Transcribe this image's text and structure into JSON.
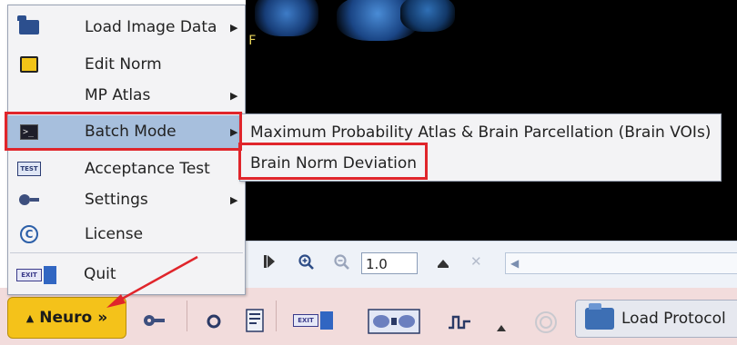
{
  "viewer": {
    "orientation_marker": "F",
    "zoom_value": "1.0"
  },
  "menu": {
    "items": [
      {
        "label": "Load Image Data",
        "icon": "open-folder-icon",
        "has_submenu": true
      },
      {
        "label": "Edit Norm",
        "icon": "edit-norm-icon",
        "has_submenu": false
      },
      {
        "label": "MP Atlas",
        "icon": "",
        "has_submenu": true
      },
      {
        "label": "Batch Mode",
        "icon": "terminal-icon",
        "has_submenu": true,
        "selected": true
      },
      {
        "label": "Acceptance Test",
        "icon": "test-icon",
        "has_submenu": false
      },
      {
        "label": "Settings",
        "icon": "gear-icon",
        "has_submenu": true
      },
      {
        "label": "License",
        "icon": "copyright-icon",
        "has_submenu": false
      },
      {
        "label": "Quit",
        "icon": "exit-icon",
        "has_submenu": false
      }
    ]
  },
  "submenu": {
    "items": [
      {
        "label": "Maximum Probability Atlas & Brain Parcellation (Brain VOIs)"
      },
      {
        "label": "Brain Norm Deviation"
      }
    ]
  },
  "taskbar": {
    "neuro_label": "Neuro",
    "neuro_chevron": "»",
    "load_protocol_label": "Load Protocol",
    "colors": {
      "neuro_button": "#f4c21a",
      "taskbar_bg": "#f2dcdc",
      "highlight": "#e0252b",
      "selection": "#a7bfdd"
    }
  }
}
